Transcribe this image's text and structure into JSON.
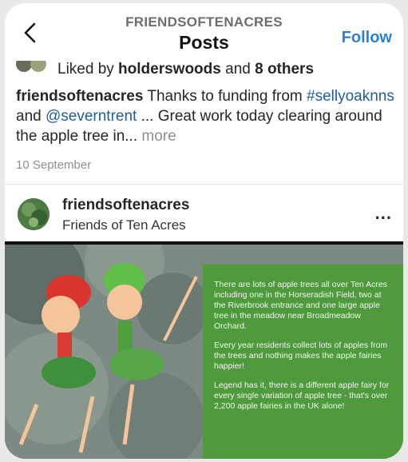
{
  "header": {
    "username": "FRIENDSOFTENACRES",
    "title": "Posts",
    "follow_label": "Follow"
  },
  "likes": {
    "prefix": "Liked by ",
    "user": "holderswoods",
    "middle": " and ",
    "others": "8 others"
  },
  "caption": {
    "username": "friendsoftenacres",
    "text1": " Thanks to funding from ",
    "tag1": "#sellyoaknns",
    "and": " and ",
    "tag2": "@severntrent",
    "text2": " ... Great work today clearing around the apple tree in... ",
    "more": "more"
  },
  "date": "10 September",
  "post": {
    "username": "friendsoftenacres",
    "subtitle": "Friends of Ten Acres",
    "menu": "..."
  },
  "image_text": {
    "p1": "There are lots of apple trees all over Ten Acres including one in the Horseradish Field, two at the Riverbrook entrance and one large apple tree in the meadow near Broadmeadow Orchard.",
    "p2": "Every year residents collect lots of apples from the trees and nothing makes the apple fairies happier!",
    "p3": "Legend has it, there is a different apple fairy for every single variation of apple tree - that's over 2,200 apple fairies in the UK alone!"
  },
  "colors": {
    "accent": "#2f7fd6",
    "green_box": "#4e9a3c"
  },
  "icons": {
    "back": "chevron-left-icon",
    "menu": "more-horizontal-icon"
  }
}
